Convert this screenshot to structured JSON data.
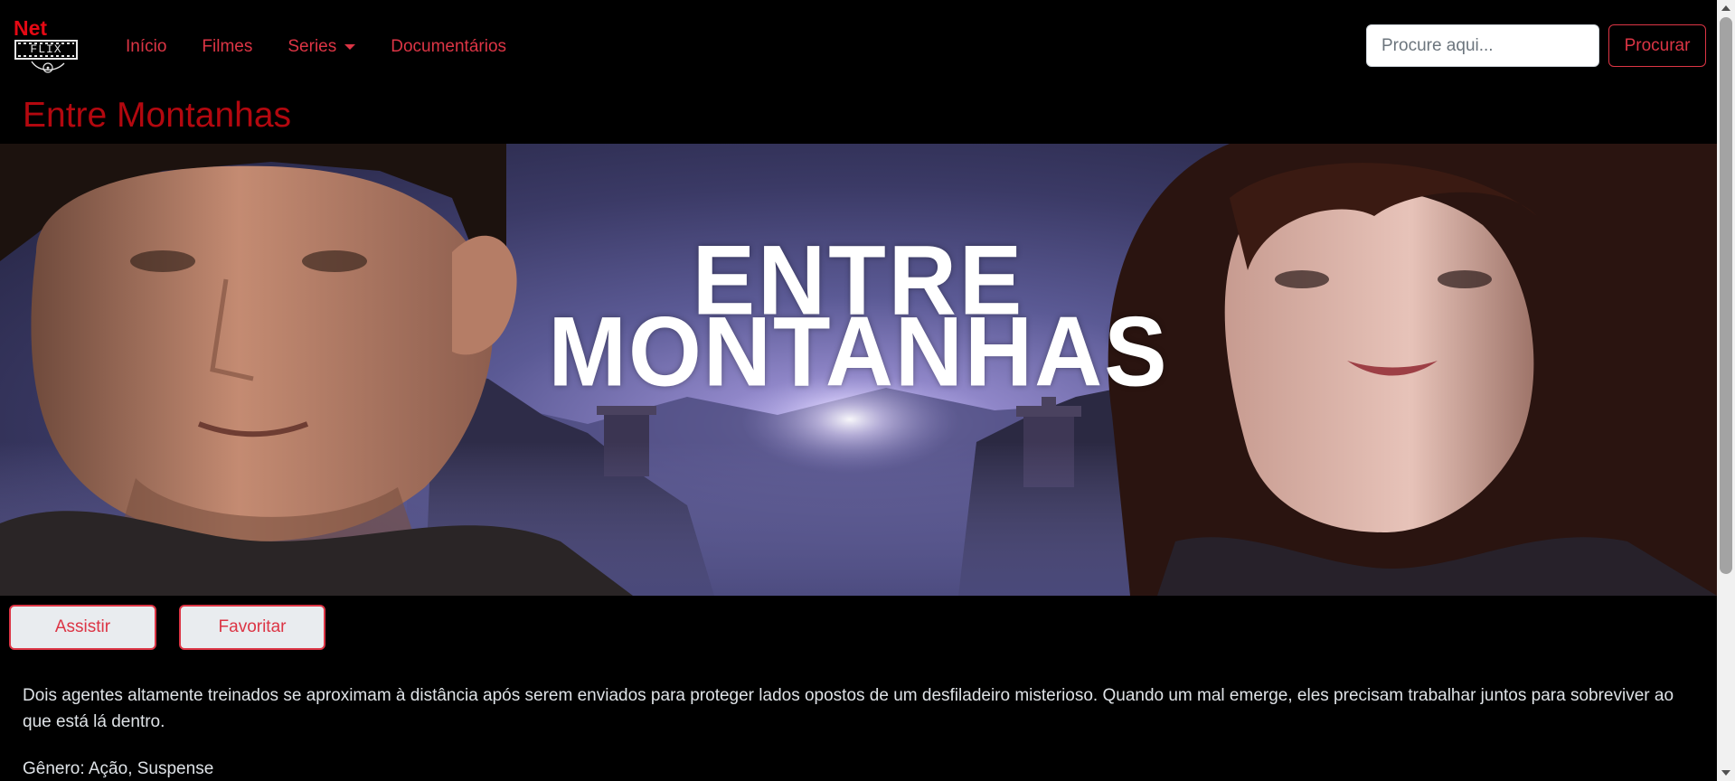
{
  "app": {
    "brand_top": "Net",
    "brand_bottom": "FLIX"
  },
  "nav": {
    "items": [
      {
        "label": "Início"
      },
      {
        "label": "Filmes"
      },
      {
        "label": "Series"
      },
      {
        "label": "Documentários"
      }
    ]
  },
  "search": {
    "placeholder": "Procure aqui...",
    "value": "",
    "button_label": "Procurar"
  },
  "movie": {
    "title": "Entre Montanhas",
    "banner": {
      "line1": "ENTRE",
      "line2": "MONTANHAS"
    },
    "actions": {
      "watch": "Assistir",
      "favorite": "Favoritar"
    },
    "description": "Dois agentes altamente treinados se aproximam à distância após serem enviados para proteger lados opostos de um desfiladeiro misterioso. Quando um mal emerge, eles precisam trabalhar juntos para sobreviver ao que está lá dentro.",
    "genre": "Gênero: Ação, Suspense"
  },
  "icons": {
    "dropdown": "chevron-down-icon",
    "scroll_up": "arrow-up-icon",
    "scroll_down": "arrow-down-icon"
  },
  "colors": {
    "background": "#000000",
    "accent": "#dc3545",
    "brand": "#e50914",
    "title": "#b3080f",
    "text": "#dee2e6",
    "banner_sky": "#5b5a95"
  }
}
